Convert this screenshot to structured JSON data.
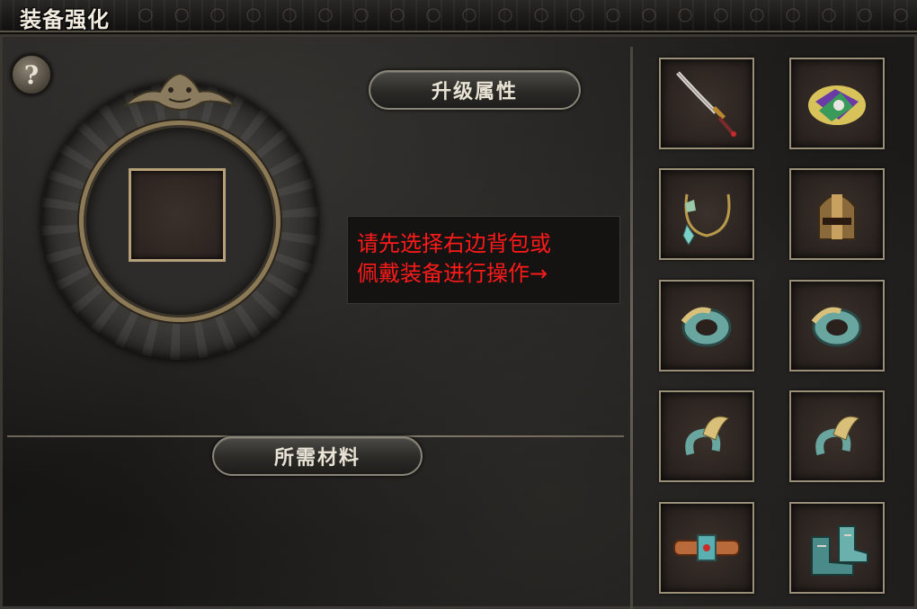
{
  "window": {
    "title": "装备强化"
  },
  "help": {
    "glyph": "?"
  },
  "panel": {
    "attr_button": "升级属性",
    "materials_button": "所需材料",
    "hint_lines": [
      "请先选择右边背包或",
      "佩戴装备进行操作→"
    ],
    "hint_color": "#ff1a1a"
  },
  "inventory": {
    "items": [
      {
        "icon": "sword-icon"
      },
      {
        "icon": "armor-icon"
      },
      {
        "icon": "necklace-icon"
      },
      {
        "icon": "helmet-icon"
      },
      {
        "icon": "bracelet-icon"
      },
      {
        "icon": "bracelet-icon"
      },
      {
        "icon": "ring-icon"
      },
      {
        "icon": "ring-icon"
      },
      {
        "icon": "belt-icon"
      },
      {
        "icon": "boots-icon"
      }
    ]
  }
}
